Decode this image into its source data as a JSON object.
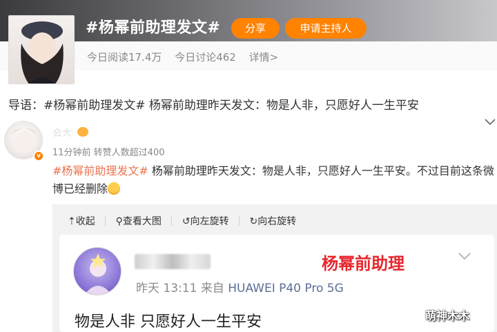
{
  "topic": {
    "title": "#杨幂前助理发文#",
    "share_label": "分享",
    "host_label": "申请主持人",
    "reads": "今日阅读17.4万",
    "discussions": "今日讨论462",
    "details": "详情>"
  },
  "intro": "导语：#杨幂前助理发文# 杨幂前助理昨天发文：物是人非，只愿好人一生平安",
  "post": {
    "author": "会大",
    "verified_badge": "v",
    "meta": "11分钟前 转赞人数超过400",
    "hashtag": "#杨幂前助理发文#",
    "text": " 杨幂前助理昨天发文：物是人非，只愿好人一生平安。不过目前这条微博已经删除"
  },
  "toolbar": {
    "collapse": "收起",
    "view_large": "查看大图",
    "rotate_left": "向左旋转",
    "rotate_right": "向右旋转"
  },
  "card": {
    "label": "杨幂前助理",
    "time": "昨天 13:11",
    "source_prefix": "来自",
    "source": "HUAWEI P40 Pro 5G",
    "text": "物是人非 只愿好人一生平安"
  },
  "watermark": "萌神木木",
  "colors": {
    "accent": "#ff8200",
    "hashtag": "#eb7350",
    "label_red": "#e8262d"
  }
}
